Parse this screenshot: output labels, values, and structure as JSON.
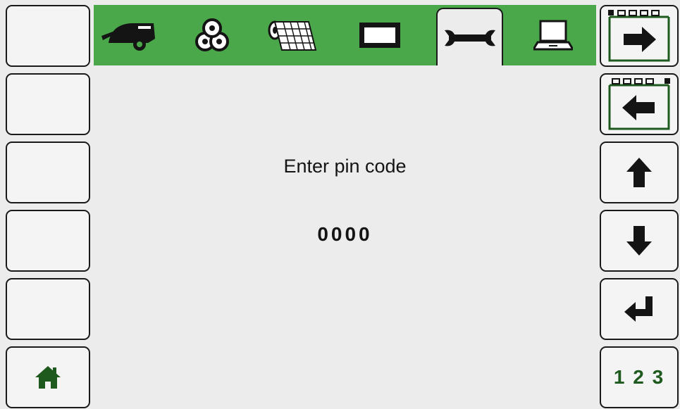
{
  "left_softkeys": [
    {
      "label": ""
    },
    {
      "label": ""
    },
    {
      "label": ""
    },
    {
      "label": ""
    },
    {
      "label": ""
    },
    {
      "label": "",
      "icon": "home-icon"
    }
  ],
  "tabs": [
    {
      "icon": "baler-machine-icon",
      "active": false
    },
    {
      "icon": "bale-rolls-icon",
      "active": false
    },
    {
      "icon": "net-wrap-icon",
      "active": false
    },
    {
      "icon": "display-screen-icon",
      "active": false
    },
    {
      "icon": "wrench-icon",
      "active": true
    },
    {
      "icon": "laptop-icon",
      "active": false
    }
  ],
  "main": {
    "prompt": "Enter pin code",
    "pin_value": "0000"
  },
  "right_softkeys": [
    {
      "icon": "next-page-arrow-right-icon"
    },
    {
      "icon": "prev-page-arrow-left-icon"
    },
    {
      "icon": "arrow-up-icon"
    },
    {
      "icon": "arrow-down-icon"
    },
    {
      "icon": "enter-return-icon"
    },
    {
      "label": "1 2 3"
    }
  ],
  "colors": {
    "accent_green": "#4aa84a",
    "icon_green": "#1e5a1e",
    "background": "#ececec"
  }
}
